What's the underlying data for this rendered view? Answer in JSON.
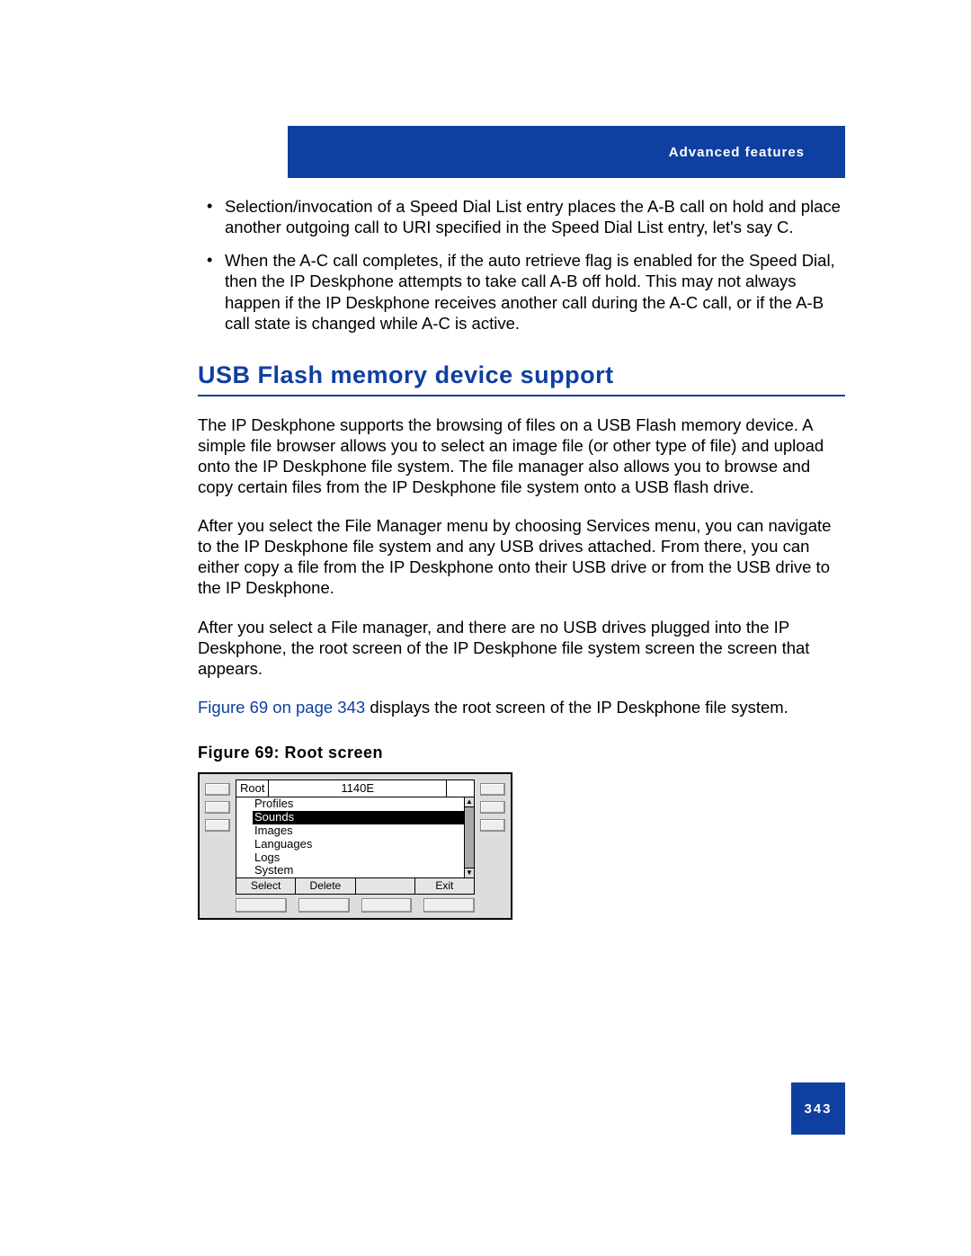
{
  "header": {
    "section": "Advanced features"
  },
  "bullets": [
    "Selection/invocation of a Speed Dial List entry places the A-B call on hold and place another outgoing call to URI specified in the Speed Dial List entry, let's say C.",
    "When the A-C call completes, if the auto retrieve flag is enabled for the Speed Dial, then the IP Deskphone attempts to take call A-B off hold. This may not always happen if the IP Deskphone receives another call during the A-C call, or if the A-B call state is changed while A-C is active."
  ],
  "heading": "USB Flash memory device support",
  "paragraphs": {
    "p1": "The IP Deskphone supports the browsing of files on a USB Flash memory device. A simple file browser allows you to select an image file (or other type of file) and upload onto the IP Deskphone file system. The file manager also allows you to browse and copy certain files from the IP Deskphone file system onto a USB flash drive.",
    "p2": "After you select the File Manager menu by choosing Services menu, you can navigate to the IP Deskphone file system and any USB drives attached. From there, you can either copy a file from the IP Deskphone onto their USB drive or from the USB drive to the IP Deskphone.",
    "p3": "After you select a File manager, and there are no USB drives plugged into the IP Deskphone, the root screen of the IP Deskphone file system screen the screen that appears.",
    "p4_ref": "Figure 69 on page 343",
    "p4_tail": " displays the root screen of the IP Deskphone file system."
  },
  "figure": {
    "caption": "Figure 69: Root screen",
    "device": {
      "title": "Root",
      "model": "1140E",
      "items": [
        "Profiles",
        "Sounds",
        "Images",
        "Languages",
        "Logs",
        "System"
      ],
      "selected_index": 1,
      "softkeys": [
        "Select",
        "Delete",
        "",
        "Exit"
      ]
    }
  },
  "page_number": "343"
}
